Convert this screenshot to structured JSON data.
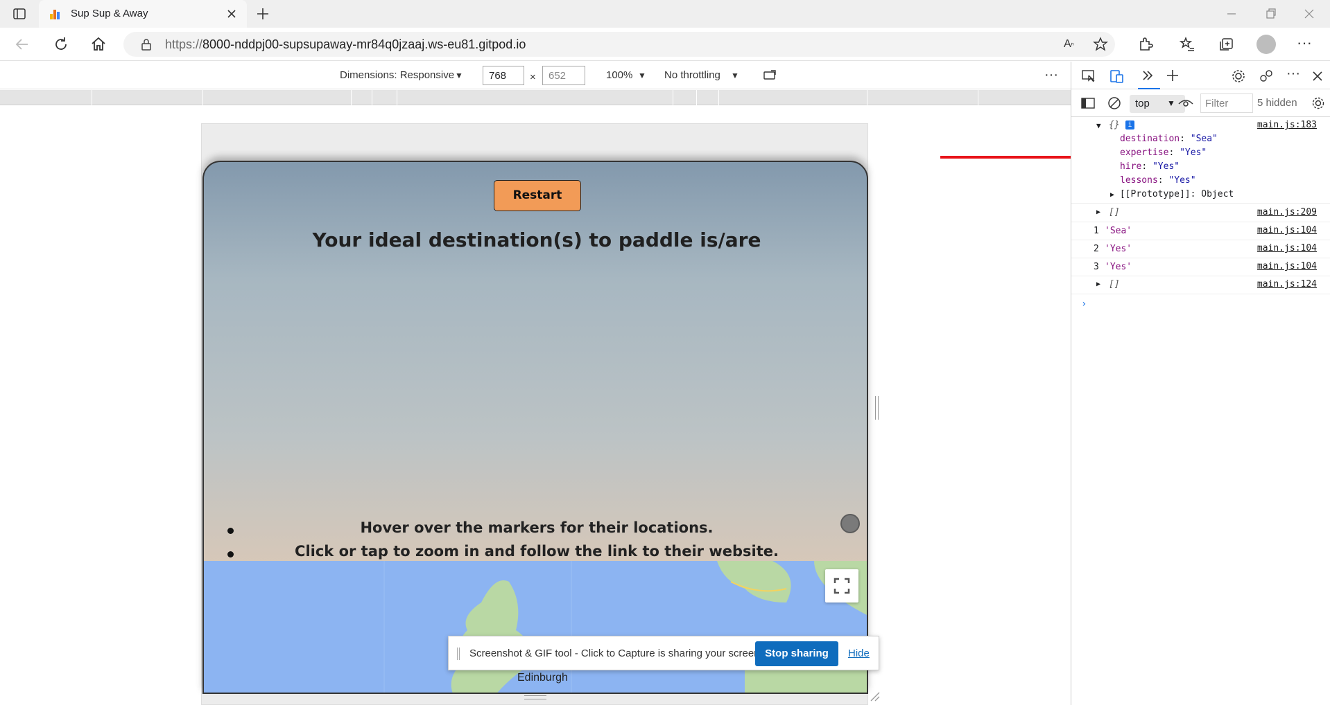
{
  "browser": {
    "tab_title": "Sup Sup & Away",
    "url_prefix": "https://",
    "url_host": "8000-nddpj00-supsupaway-mr84q0jzaaj.ws-eu81.gitpod.io"
  },
  "device_toolbar": {
    "dimensions_label": "Dimensions: Responsive",
    "width": "768",
    "times": "×",
    "height": "652",
    "zoom": "100%",
    "throttling": "No throttling"
  },
  "page": {
    "restart_label": "Restart",
    "headline": "Your ideal destination(s) to paddle is/are",
    "instructions": [
      "Hover over the markers for their locations.",
      "Click or tap to zoom in and follow the link to their website."
    ],
    "map_city": "Edinburgh"
  },
  "share_banner": {
    "message": "Screenshot & GIF tool - Click to Capture is sharing your screen.",
    "stop_label": "Stop sharing",
    "hide_label": "Hide"
  },
  "devtools": {
    "context": "top",
    "filter_placeholder": "Filter",
    "hidden_count": "5 hidden",
    "object_header": "{}",
    "object_source": "main.js:183",
    "props": [
      {
        "key": "destination",
        "value": "\"Sea\""
      },
      {
        "key": "expertise",
        "value": "\"Yes\""
      },
      {
        "key": "hire",
        "value": "\"Yes\""
      },
      {
        "key": "lessons",
        "value": "\"Yes\""
      }
    ],
    "prototype": "[[Prototype]]: Object",
    "rows": [
      {
        "prefix": "",
        "text": "[]",
        "source": "main.js:209"
      },
      {
        "prefix": "1",
        "text": "'Sea'",
        "source": "main.js:104"
      },
      {
        "prefix": "2",
        "text": "'Yes'",
        "source": "main.js:104"
      },
      {
        "prefix": "3",
        "text": "'Yes'",
        "source": "main.js:104"
      },
      {
        "prefix": "",
        "text": "[]",
        "source": "main.js:124"
      }
    ]
  },
  "colors": {
    "restart_button": "#f29b57",
    "annotation_arrow": "#e8141a",
    "map_water": "#8cb4f2",
    "share_button": "#0f6cbd"
  }
}
